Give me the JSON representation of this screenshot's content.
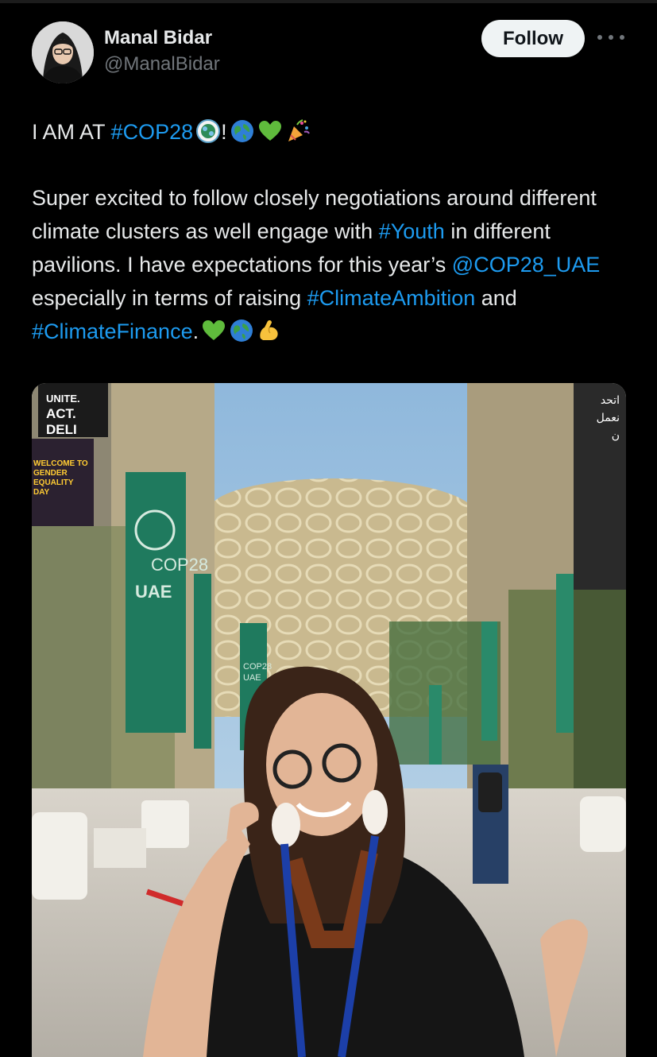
{
  "header": {
    "name": "Manal Bidar",
    "handle": "@ManalBidar",
    "follow_label": "Follow"
  },
  "tweet": {
    "line1_prefix": "I AM AT ",
    "line1_hashtag": "#COP28",
    "line1_suffix": "!",
    "p2_text1": "Super excited to follow closely negotiations around different climate clusters as well engage with ",
    "p2_youth": "#Youth",
    "p2_text2": " in different pavilions. I have expectations for this year’s ",
    "p2_mention": "@COP28_UAE",
    "p2_text3": " especially in terms of raising ",
    "p2_ambition": "#ClimateAmbition",
    "p2_text4": " and ",
    "p2_finance": "#ClimateFinance",
    "p2_text5": "."
  },
  "icons": {
    "line1": [
      "cop28-logo-icon",
      "globe-icon",
      "green-heart-icon",
      "party-popper-icon"
    ],
    "line2": [
      "green-heart-icon",
      "globe-icon",
      "flexed-biceps-icon"
    ]
  },
  "photo": {
    "left_banner_lines": [
      "UNITE.",
      "ACT.",
      "DELI"
    ],
    "left_screen_lines": [
      "WELCOME TO",
      "GENDER",
      "EQUALITY",
      "DAY"
    ],
    "flag_lines": [
      "COP28",
      "UAE"
    ],
    "small_flag_lines": [
      "COP28",
      "UAE"
    ],
    "right_banner_lines": [
      "اتحد",
      "نعمل",
      "ن"
    ],
    "colors": {
      "sky": "#9ec3e0",
      "dome": "#c9b98f",
      "flag": "#1f7a5e",
      "pavement": "#c9c4bb"
    }
  }
}
